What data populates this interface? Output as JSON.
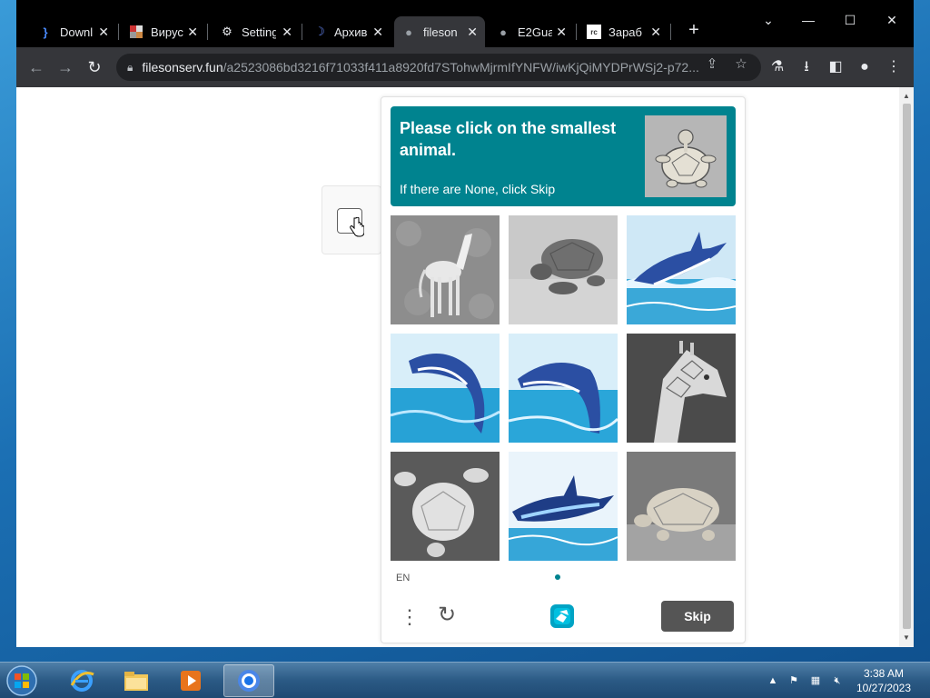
{
  "browser": {
    "tabs": [
      {
        "title": "Downl",
        "icon": "brace-icon"
      },
      {
        "title": "Вирус",
        "icon": "image-icon"
      },
      {
        "title": "Setting",
        "icon": "gear-icon"
      },
      {
        "title": "Архив",
        "icon": "crescent-icon"
      },
      {
        "title": "fileson",
        "icon": "globe-icon",
        "active": true
      },
      {
        "title": "E2Gua",
        "icon": "globe-icon"
      },
      {
        "title": "Зараб",
        "icon": "rc-icon"
      }
    ],
    "address": {
      "host": "filesonserv.fun",
      "path": "/a2523086bd3216f71033f411a8920fd7STohwMjrmIfYNFW/iwKjQiMYDPrWSj2-p72..."
    }
  },
  "challenge": {
    "prompt": "Please click on the smallest animal.",
    "sub": "If there are None, click Skip",
    "language": "EN",
    "skip_label": "Skip",
    "images": [
      "horse",
      "turtle",
      "dolphin",
      "dolphin",
      "whale",
      "giraffe",
      "turtle",
      "dolphin",
      "turtle"
    ]
  },
  "colors": {
    "accent": "#00838f",
    "skip": "#555555"
  },
  "taskbar": {
    "time": "3:38 AM",
    "date": "10/27/2023"
  }
}
